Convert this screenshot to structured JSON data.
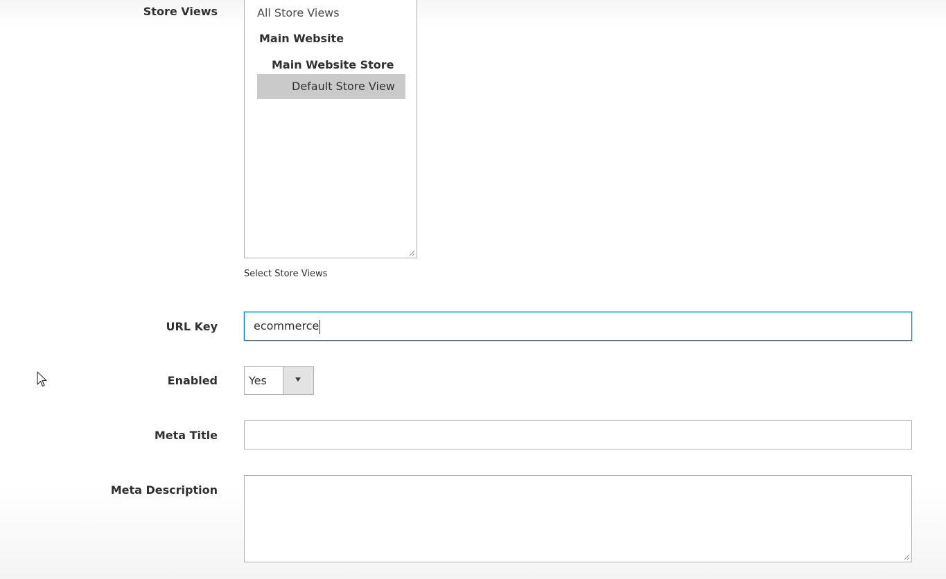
{
  "fields": {
    "store_views": {
      "label": "Store Views",
      "options": {
        "all": "All Store Views",
        "website": "Main Website",
        "store": "Main Website Store",
        "view": "Default Store View"
      },
      "selected": "Default Store View",
      "note": "Select Store Views"
    },
    "url_key": {
      "label": "URL Key",
      "value": "ecommerce"
    },
    "enabled": {
      "label": "Enabled",
      "value": "Yes",
      "arrow_icon": "caret-down-icon"
    },
    "meta_title": {
      "label": "Meta Title",
      "value": ""
    },
    "meta_description": {
      "label": "Meta Description",
      "value": ""
    }
  },
  "colors": {
    "focus_border": "#007bdb",
    "selected_option_bg": "#cacaca",
    "select_button_bg": "#e3e3e3",
    "border": "#adadad"
  }
}
